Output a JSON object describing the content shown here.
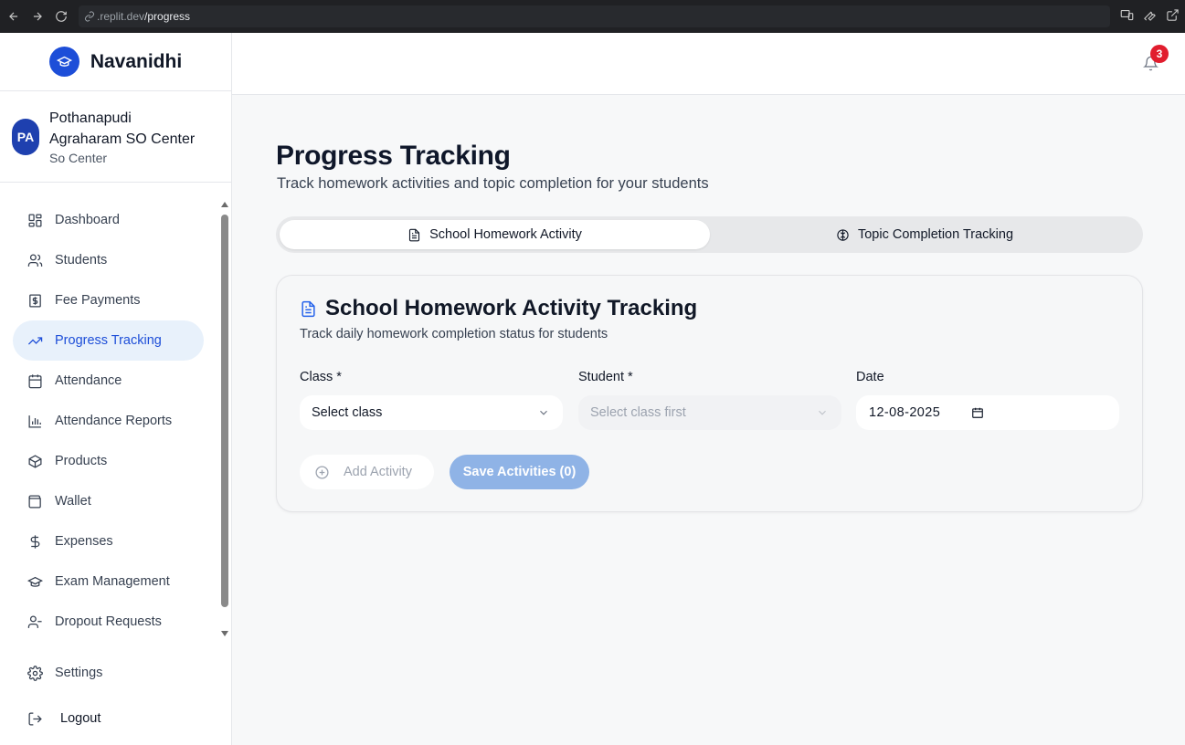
{
  "browser": {
    "url_host": ".replit.dev",
    "url_path": "/progress"
  },
  "sidebar": {
    "brand_name": "Navanidhi",
    "center": {
      "initials": "PA",
      "name_line1": "Pothanapudi",
      "name_line2": "Agraharam SO Center",
      "type": "So Center"
    },
    "items": [
      {
        "label": "Dashboard",
        "icon": "dashboard-icon"
      },
      {
        "label": "Students",
        "icon": "users-icon"
      },
      {
        "label": "Fee Payments",
        "icon": "dollar-receipt-icon"
      },
      {
        "label": "Progress Tracking",
        "icon": "trending-up-icon",
        "active": true
      },
      {
        "label": "Attendance",
        "icon": "calendar-icon"
      },
      {
        "label": "Attendance Reports",
        "icon": "bar-chart-icon"
      },
      {
        "label": "Products",
        "icon": "package-icon"
      },
      {
        "label": "Wallet",
        "icon": "wallet-icon"
      },
      {
        "label": "Expenses",
        "icon": "dollar-icon"
      },
      {
        "label": "Exam Management",
        "icon": "graduation-cap-icon"
      },
      {
        "label": "Dropout Requests",
        "icon": "user-minus-icon"
      }
    ],
    "settings_label": "Settings",
    "logout_label": "Logout"
  },
  "header": {
    "notification_count": "3"
  },
  "page": {
    "title": "Progress Tracking",
    "subtitle": "Track homework activities and topic completion for your students",
    "tabs": [
      {
        "label": "School Homework Activity",
        "active": true
      },
      {
        "label": "Topic Completion Tracking",
        "active": false
      }
    ]
  },
  "card": {
    "title": "School Homework Activity Tracking",
    "subtitle": "Track daily homework completion status for students",
    "class_label": "Class *",
    "class_value": "Select class",
    "student_label": "Student *",
    "student_value": "Select class first",
    "date_label": "Date",
    "date_value": "12-08-2025",
    "add_activity_label": "Add Activity",
    "save_label": "Save Activities (0)"
  },
  "colors": {
    "accent": "#1d4ed8",
    "active_bg": "#e8f1fb",
    "badge": "#e11d2e",
    "save_button": "#8fb3e6"
  }
}
